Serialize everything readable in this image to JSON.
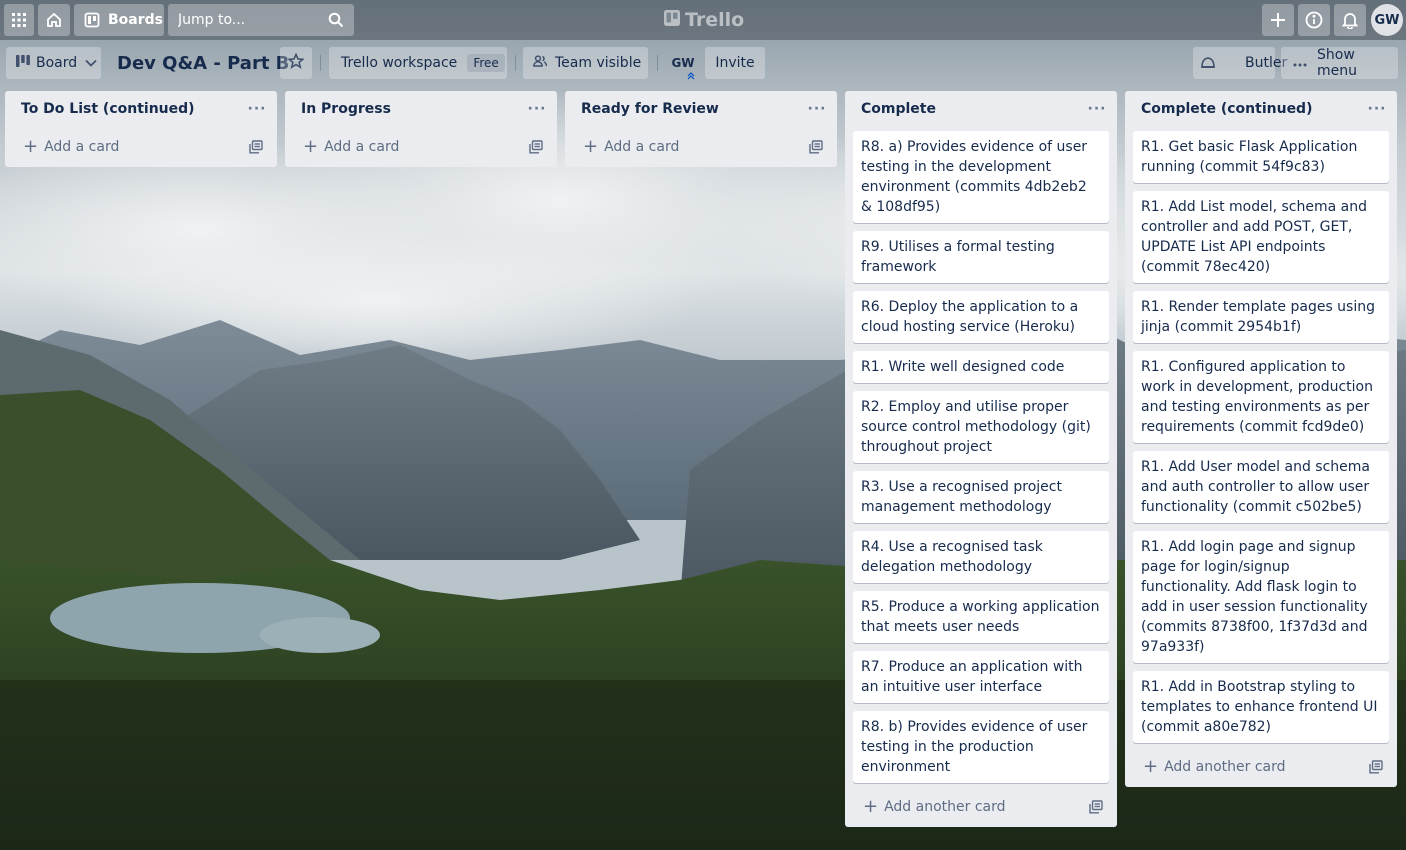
{
  "nav": {
    "apps_icon": "grid-icon",
    "home_icon": "home-icon",
    "boards_label": "Boards",
    "search_placeholder": "Jump to...",
    "logo_text": "Trello",
    "avatar": "GW"
  },
  "board": {
    "view_label": "Board",
    "title": "Dev Q&A - Part B",
    "workspace_label": "Trello workspace",
    "workspace_badge": "Free",
    "visibility_label": "Team visible",
    "member_initials": "GW",
    "invite_label": "Invite",
    "butler_label": "Butler",
    "show_menu_label": "Show menu"
  },
  "lists": [
    {
      "title": "To Do List (continued)",
      "cards": [],
      "add_label": "Add a card"
    },
    {
      "title": "In Progress",
      "cards": [],
      "add_label": "Add a card"
    },
    {
      "title": "Ready for Review",
      "cards": [],
      "add_label": "Add a card"
    },
    {
      "title": "Complete",
      "cards": [
        "R8. a) Provides evidence of user testing in the development environment (commits 4db2eb2 & 108df95)",
        "R9. Utilises a formal testing framework",
        "R6. Deploy the application to a cloud hosting service (Heroku)",
        "R1. Write well designed code",
        "R2. Employ and utilise proper source control methodology (git) throughout project",
        "R3. Use a recognised project management methodology",
        "R4. Use a recognised task delegation methodology",
        "R5. Produce a working application that meets user needs",
        "R7. Produce an application with an intuitive user interface",
        "R8. b) Provides evidence of user testing in the production environment"
      ],
      "add_label": "Add another card"
    },
    {
      "title": "Complete (continued)",
      "cards": [
        "R1. Get basic Flask Application running (commit 54f9c83)",
        "R1. Add List model, schema and controller and add POST, GET, UPDATE List API endpoints (commit 78ec420)",
        "R1. Render template pages using jinja (commit 2954b1f)",
        "R1. Configured application to work in development, production and testing environments as per requirements (commit fcd9de0)",
        "R1. Add User model and schema and auth controller to allow user functionality (commit c502be5)",
        "R1. Add login page and signup page for login/signup functionality. Add flask login to add in user session functionality (commits 8738f00, 1f37d3d and 97a933f)",
        "R1. Add in Bootstrap styling to templates to enhance frontend UI (commit a80e782)"
      ],
      "add_label": "Add another card"
    }
  ]
}
